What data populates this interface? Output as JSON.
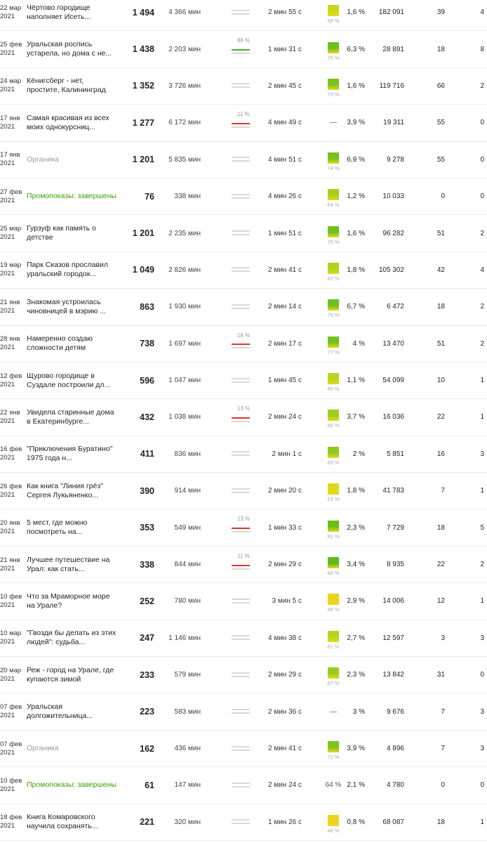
{
  "rows": [
    {
      "date": "22 мар 2021",
      "title": "Чёртово городище наполняет Исеть...",
      "title_style": "normal",
      "views": "1 494",
      "read_time": "4 366 мин",
      "bar": {
        "type": "plain",
        "pct": ""
      },
      "avg_time": "2 мин 55 с",
      "score": {
        "pct": "58 %",
        "color": "#c8d61e"
      },
      "ctr": "1,6 %",
      "impressions": "182 091",
      "col1": "39",
      "col2": "4"
    },
    {
      "date": "25 фев 2021",
      "title": "Уральская роспись устарела, но дома с не...",
      "title_style": "normal",
      "views": "1 438",
      "read_time": "2 203 мин",
      "bar": {
        "type": "green",
        "pct": "86 %"
      },
      "avg_time": "1 мин 31 с",
      "score": {
        "pct": "79 %",
        "color": "#6fbf1f"
      },
      "ctr": "6,3 %",
      "impressions": "28 891",
      "col1": "18",
      "col2": "8"
    },
    {
      "date": "24 мар 2021",
      "title": "Кёнигсберг - нет, простите, Калининград",
      "title_style": "normal",
      "views": "1 352",
      "read_time": "3 726 мин",
      "bar": {
        "type": "plain",
        "pct": ""
      },
      "avg_time": "2 мин 45 с",
      "score": {
        "pct": "73 %",
        "color": "#7cc21e"
      },
      "ctr": "1,6 %",
      "impressions": "119 716",
      "col1": "66",
      "col2": "2"
    },
    {
      "date": "17 янв 2021",
      "title": "Самая красивая из всех моих однокурсниц...",
      "title_style": "normal",
      "views": "1 277",
      "read_time": "6 172 мин",
      "bar": {
        "type": "red",
        "pct": "11 %"
      },
      "avg_time": "4 мин 49 с",
      "score": {
        "pct": "",
        "color": "",
        "dash": "—"
      },
      "ctr": "3,9 %",
      "impressions": "19 311",
      "col1": "55",
      "col2": "0"
    },
    {
      "date": "17 янв 2021",
      "title": "Органика",
      "title_style": "muted",
      "views": "1 201",
      "read_time": "5 835 мин",
      "bar": {
        "type": "plain",
        "pct": ""
      },
      "avg_time": "4 мин 51 с",
      "score": {
        "pct": "74 %",
        "color": "#78c11e"
      },
      "ctr": "6,9 %",
      "impressions": "9 278",
      "col1": "55",
      "col2": "0"
    },
    {
      "date": "27 фев 2021",
      "title": "Промопоказы: завершены",
      "title_style": "green",
      "views": "76",
      "read_time": "338 мин",
      "bar": {
        "type": "plain",
        "pct": ""
      },
      "avg_time": "4 мин 26 с",
      "score": {
        "pct": "64 %",
        "color": "#a8cf1e"
      },
      "ctr": "1,2 %",
      "impressions": "10 033",
      "col1": "0",
      "col2": "0"
    },
    {
      "date": "25 мар 2021",
      "title": "Гурзуф как память о детстве",
      "title_style": "normal",
      "views": "1 201",
      "read_time": "2 235 мин",
      "bar": {
        "type": "plain",
        "pct": ""
      },
      "avg_time": "1 мин 51 с",
      "score": {
        "pct": "79 %",
        "color": "#6fbf1f"
      },
      "ctr": "1,6 %",
      "impressions": "96 282",
      "col1": "51",
      "col2": "2"
    },
    {
      "date": "19 мар 2021",
      "title": "Парк Сказов прославил уральский городок...",
      "title_style": "normal",
      "views": "1 049",
      "read_time": "2 826 мин",
      "bar": {
        "type": "plain",
        "pct": ""
      },
      "avg_time": "2 мин 41 с",
      "score": {
        "pct": "62 %",
        "color": "#b2d21e"
      },
      "ctr": "1,8 %",
      "impressions": "105 302",
      "col1": "42",
      "col2": "4"
    },
    {
      "date": "21 янв 2021",
      "title": "Знакомая устроилась чиновницей в мэрию ...",
      "title_style": "normal",
      "views": "863",
      "read_time": "1 930 мин",
      "bar": {
        "type": "plain",
        "pct": ""
      },
      "avg_time": "2 мин 14 с",
      "score": {
        "pct": "79 %",
        "color": "#6fbf1f"
      },
      "ctr": "6,7 %",
      "impressions": "6 472",
      "col1": "18",
      "col2": "2"
    },
    {
      "date": "28 янв 2021",
      "title": "Намеренно создаю сложности детям",
      "title_style": "normal",
      "views": "738",
      "read_time": "1 697 мин",
      "bar": {
        "type": "red",
        "pct": "18 %"
      },
      "avg_time": "2 мин 17 с",
      "score": {
        "pct": "77 %",
        "color": "#73c01f"
      },
      "ctr": "4 %",
      "impressions": "13 470",
      "col1": "51",
      "col2": "2"
    },
    {
      "date": "12 фев 2021",
      "title": "Щурово городище в Суздале построили дл...",
      "title_style": "normal",
      "views": "596",
      "read_time": "1 047 мин",
      "bar": {
        "type": "plain",
        "pct": ""
      },
      "avg_time": "1 мин 45 с",
      "score": {
        "pct": "60 %",
        "color": "#bcd41e"
      },
      "ctr": "1,1 %",
      "impressions": "54 099",
      "col1": "10",
      "col2": "1"
    },
    {
      "date": "22 янв 2021",
      "title": "Увидела старинные дома в Екатеринбурге...",
      "title_style": "normal",
      "views": "432",
      "read_time": "1 038 мин",
      "bar": {
        "type": "red",
        "pct": "13 %"
      },
      "avg_time": "2 мин 24 с",
      "score": {
        "pct": "66 %",
        "color": "#a0cd1e"
      },
      "ctr": "3,7 %",
      "impressions": "16 036",
      "col1": "22",
      "col2": "1"
    },
    {
      "date": "16 фев 2021",
      "title": "\"Приключения Буратино\" 1975 года н...",
      "title_style": "normal",
      "views": "411",
      "read_time": "836 мин",
      "bar": {
        "type": "plain",
        "pct": ""
      },
      "avg_time": "2 мин 1 с",
      "score": {
        "pct": "69 %",
        "color": "#8fca1e"
      },
      "ctr": "2 %",
      "impressions": "5 851",
      "col1": "16",
      "col2": "3"
    },
    {
      "date": "26 фев 2021",
      "title": "Как книга \"Линия грёз\" Сергея Лукьяненко...",
      "title_style": "normal",
      "views": "390",
      "read_time": "914 мин",
      "bar": {
        "type": "plain",
        "pct": ""
      },
      "avg_time": "2 мин 20 с",
      "score": {
        "pct": "53 %",
        "color": "#dcd81e"
      },
      "ctr": "1,8 %",
      "impressions": "41 783",
      "col1": "7",
      "col2": "1"
    },
    {
      "date": "20 янв 2021",
      "title": "5 мест, где можно посмотреть на...",
      "title_style": "normal",
      "views": "353",
      "read_time": "549 мин",
      "bar": {
        "type": "red",
        "pct": "13 %"
      },
      "avg_time": "1 мин 33 с",
      "score": {
        "pct": "81 %",
        "color": "#68bd1f"
      },
      "ctr": "2,3 %",
      "impressions": "7 729",
      "col1": "18",
      "col2": "5"
    },
    {
      "date": "21 янв 2021",
      "title": "Лучшее путешествие на Урал: как стать...",
      "title_style": "normal",
      "views": "338",
      "read_time": "844 мин",
      "bar": {
        "type": "red",
        "pct": "11 %"
      },
      "avg_time": "2 мин 29 с",
      "score": {
        "pct": "84 %",
        "color": "#5fba1f"
      },
      "ctr": "3,4 %",
      "impressions": "8 935",
      "col1": "22",
      "col2": "2"
    },
    {
      "date": "10 фев 2021",
      "title": "Что за Мраморное море на Урале?",
      "title_style": "normal",
      "views": "252",
      "read_time": "780 мин",
      "bar": {
        "type": "plain",
        "pct": ""
      },
      "avg_time": "3 мин 5 с",
      "score": {
        "pct": "46 %",
        "color": "#eed21e"
      },
      "ctr": "2,9 %",
      "impressions": "14 006",
      "col1": "12",
      "col2": "1"
    },
    {
      "date": "10 мар 2021",
      "title": "\"Гвозди бы делать из этих людей\": судьба...",
      "title_style": "normal",
      "views": "247",
      "read_time": "1 146 мин",
      "bar": {
        "type": "plain",
        "pct": ""
      },
      "avg_time": "4 мин 38 с",
      "score": {
        "pct": "61 %",
        "color": "#b8d31e"
      },
      "ctr": "2,7 %",
      "impressions": "12 597",
      "col1": "3",
      "col2": "3"
    },
    {
      "date": "20 мар 2021",
      "title": "Реж - город на Урале, где купаются зимой",
      "title_style": "normal",
      "views": "233",
      "read_time": "579 мин",
      "bar": {
        "type": "plain",
        "pct": ""
      },
      "avg_time": "2 мин 29 с",
      "score": {
        "pct": "67 %",
        "color": "#9acc1e"
      },
      "ctr": "2,3 %",
      "impressions": "13 842",
      "col1": "31",
      "col2": "0"
    },
    {
      "date": "07 фев 2021",
      "title": "Уральская долгожительница...",
      "title_style": "normal",
      "views": "223",
      "read_time": "583 мин",
      "bar": {
        "type": "plain",
        "pct": ""
      },
      "avg_time": "2 мин 36 с",
      "score": {
        "pct": "",
        "color": "",
        "dash": "—"
      },
      "ctr": "3 %",
      "impressions": "9 676",
      "col1": "7",
      "col2": "3"
    },
    {
      "date": "07 фев 2021",
      "title": "Органика",
      "title_style": "muted",
      "views": "162",
      "read_time": "436 мин",
      "bar": {
        "type": "plain",
        "pct": ""
      },
      "avg_time": "2 мин 41 с",
      "score": {
        "pct": "72 %",
        "color": "#80c41e"
      },
      "ctr": "3,9 %",
      "impressions": "4 896",
      "col1": "7",
      "col2": "3"
    },
    {
      "date": "10 фев 2021",
      "title": "Промопоказы: завершены",
      "title_style": "green",
      "views": "61",
      "read_time": "147 мин",
      "bar": {
        "type": "plain",
        "pct": ""
      },
      "avg_time": "2 мин 24 с",
      "score": {
        "pct": "",
        "color": "",
        "text": "64 %"
      },
      "ctr": "2,1 %",
      "impressions": "4 780",
      "col1": "0",
      "col2": "0"
    },
    {
      "date": "18 фев 2021",
      "title": "Книга Комаровского научила сохранять...",
      "title_style": "normal",
      "views": "221",
      "read_time": "320 мин",
      "bar": {
        "type": "plain",
        "pct": ""
      },
      "avg_time": "1 мин 26 с",
      "score": {
        "pct": "46 %",
        "color": "#eed21e"
      },
      "ctr": "0,8 %",
      "impressions": "68 087",
      "col1": "18",
      "col2": "1"
    }
  ]
}
